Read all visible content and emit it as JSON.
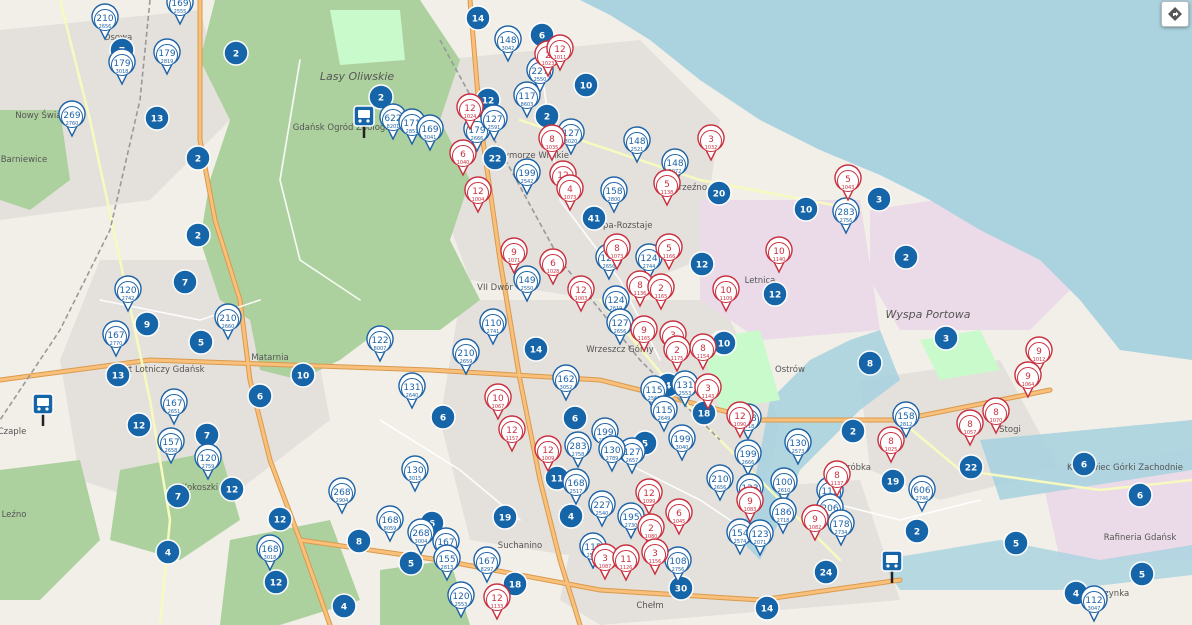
{
  "colors": {
    "water": "#aad3df",
    "land": "#f2efe9",
    "forest": "#add19e",
    "park": "#c8facc",
    "industrial": "#ebdbe8",
    "residential": "#e0dfdf",
    "highway": "#f8c07a",
    "highway_edge": "#d99a4e",
    "cluster_blue": "#1565a8",
    "pin_blue": "#1e63a6",
    "pin_red": "#c8303f"
  },
  "map_labels": [
    {
      "text": "Osowa"
    },
    {
      "text": "Nowy Świat"
    },
    {
      "text": "Barniewice"
    },
    {
      "text": "Matarnia"
    },
    {
      "text": "Lasy Oliwskie"
    },
    {
      "text": "Gdańsk Ogród Zoologiczny"
    },
    {
      "text": "Przymorze Wielkie"
    },
    {
      "text": "Brzeźno"
    },
    {
      "text": "Letnica"
    },
    {
      "text": "Wyspa Portowa"
    },
    {
      "text": "Stogi"
    },
    {
      "text": "Krakowiec Górki Zachodnie"
    },
    {
      "text": "Rafineria Gdańsk"
    },
    {
      "text": "Olszynka"
    },
    {
      "text": "Suchanino"
    },
    {
      "text": "Chełm"
    },
    {
      "text": "Kokoszki"
    },
    {
      "text": "Wrzeszcz Górny"
    },
    {
      "text": "VII Dwór"
    },
    {
      "text": "Zaspa-Rozstaje"
    },
    {
      "text": "Przeróbka"
    },
    {
      "text": "Ostrów"
    },
    {
      "text": "Czaple"
    },
    {
      "text": "Leźno"
    },
    {
      "text": "Port Lotniczy Gdańsk"
    }
  ],
  "clusters": [
    {
      "label": "14"
    },
    {
      "label": "6"
    },
    {
      "label": "10"
    },
    {
      "label": "12"
    },
    {
      "label": "22"
    },
    {
      "label": "41"
    },
    {
      "label": "2"
    },
    {
      "label": "2"
    },
    {
      "label": "13"
    },
    {
      "label": "7"
    },
    {
      "label": "2"
    },
    {
      "label": "2"
    },
    {
      "label": "7"
    },
    {
      "label": "9"
    },
    {
      "label": "5"
    },
    {
      "label": "13"
    },
    {
      "label": "10"
    },
    {
      "label": "6"
    },
    {
      "label": "12"
    },
    {
      "label": "7"
    },
    {
      "label": "7"
    },
    {
      "label": "12"
    },
    {
      "label": "12"
    },
    {
      "label": "4"
    },
    {
      "label": "12"
    },
    {
      "label": "4"
    },
    {
      "label": "8"
    },
    {
      "label": "5"
    },
    {
      "label": "6"
    },
    {
      "label": "20"
    },
    {
      "label": "10"
    },
    {
      "label": "12"
    },
    {
      "label": "12"
    },
    {
      "label": "10"
    },
    {
      "label": "3"
    },
    {
      "label": "2"
    },
    {
      "label": "8"
    },
    {
      "label": "3"
    },
    {
      "label": "2"
    },
    {
      "label": "22"
    },
    {
      "label": "19"
    },
    {
      "label": "6"
    },
    {
      "label": "6"
    },
    {
      "label": "5"
    },
    {
      "label": "5"
    },
    {
      "label": "4"
    },
    {
      "label": "24"
    },
    {
      "label": "14"
    },
    {
      "label": "18"
    },
    {
      "label": "30"
    },
    {
      "label": "19"
    },
    {
      "label": "4"
    },
    {
      "label": "6"
    },
    {
      "label": "14"
    },
    {
      "label": "6"
    },
    {
      "label": "11"
    },
    {
      "label": "5"
    },
    {
      "label": "2"
    },
    {
      "label": "4"
    },
    {
      "label": "10"
    },
    {
      "label": "18"
    },
    {
      "label": "2"
    }
  ],
  "pins_blue": [
    {
      "line": "210",
      "sub": "2656"
    },
    {
      "line": "169",
      "sub": "2555"
    },
    {
      "line": "179",
      "sub": "2819"
    },
    {
      "line": "179",
      "sub": "3018"
    },
    {
      "line": "269",
      "sub": "2760"
    },
    {
      "line": "148",
      "sub": "3042"
    },
    {
      "line": "117",
      "sub": "8603"
    },
    {
      "line": "227",
      "sub": "2550"
    },
    {
      "line": "622",
      "sub": "8201"
    },
    {
      "line": "171",
      "sub": "2851"
    },
    {
      "line": "169",
      "sub": "3041"
    },
    {
      "line": "179",
      "sub": "2666"
    },
    {
      "line": "127",
      "sub": "2591"
    },
    {
      "line": "199",
      "sub": "2542"
    },
    {
      "line": "127",
      "sub": "8020"
    },
    {
      "line": "148",
      "sub": "2521"
    },
    {
      "line": "148",
      "sub": "3072"
    },
    {
      "line": "158",
      "sub": "2800"
    },
    {
      "line": "283",
      "sub": "2756"
    },
    {
      "line": "124",
      "sub": "2744"
    },
    {
      "line": "127",
      "sub": "2656"
    },
    {
      "line": "149",
      "sub": "2550"
    },
    {
      "line": "124",
      "sub": "2619"
    },
    {
      "line": "127",
      "sub": "2656"
    },
    {
      "line": "110",
      "sub": "2741"
    },
    {
      "line": "122",
      "sub": "8007"
    },
    {
      "line": "210",
      "sub": "2659"
    },
    {
      "line": "120",
      "sub": "2742"
    },
    {
      "line": "167",
      "sub": "2770"
    },
    {
      "line": "210",
      "sub": "2660"
    },
    {
      "line": "131",
      "sub": "2640"
    },
    {
      "line": "162",
      "sub": "3052"
    },
    {
      "line": "115",
      "sub": "2562"
    },
    {
      "line": "167",
      "sub": "2651"
    },
    {
      "line": "157",
      "sub": "2658"
    },
    {
      "line": "120",
      "sub": "2759"
    },
    {
      "line": "199",
      "sub": "2545"
    },
    {
      "line": "199",
      "sub": "3040"
    },
    {
      "line": "108",
      "sub": "2718"
    },
    {
      "line": "130",
      "sub": "2573"
    },
    {
      "line": "127",
      "sub": "2657"
    },
    {
      "line": "283",
      "sub": "2758"
    },
    {
      "line": "130",
      "sub": "2789"
    },
    {
      "line": "130",
      "sub": "3015"
    },
    {
      "line": "168",
      "sub": "2517"
    },
    {
      "line": "199",
      "sub": "2666"
    },
    {
      "line": "158",
      "sub": "2812"
    },
    {
      "line": "268",
      "sub": "2904"
    },
    {
      "line": "210",
      "sub": "2656"
    },
    {
      "line": "123",
      "sub": "2751"
    },
    {
      "line": "100",
      "sub": "2610"
    },
    {
      "line": "111",
      "sub": "2620"
    },
    {
      "line": "606",
      "sub": "2746"
    },
    {
      "line": "227",
      "sub": "2540"
    },
    {
      "line": "195",
      "sub": "2730"
    },
    {
      "line": "186",
      "sub": "2718"
    },
    {
      "line": "206",
      "sub": "2619"
    },
    {
      "line": "178",
      "sub": "2734"
    },
    {
      "line": "168",
      "sub": "8059"
    },
    {
      "line": "268",
      "sub": "3004"
    },
    {
      "line": "167",
      "sub": "2813"
    },
    {
      "line": "154",
      "sub": "2574"
    },
    {
      "line": "123",
      "sub": "2071"
    },
    {
      "line": "168",
      "sub": "3018"
    },
    {
      "line": "155",
      "sub": "2813"
    },
    {
      "line": "167",
      "sub": "8297"
    },
    {
      "line": "115",
      "sub": "2516"
    },
    {
      "line": "108",
      "sub": "2756"
    },
    {
      "line": "120",
      "sub": "2553"
    },
    {
      "line": "112",
      "sub": "3047"
    },
    {
      "line": "131",
      "sub": "2553"
    },
    {
      "line": "115",
      "sub": "2649"
    }
  ],
  "pins_red": [
    {
      "line": "2",
      "sub": "1023"
    },
    {
      "line": "12",
      "sub": "1011"
    },
    {
      "line": "12",
      "sub": "1024"
    },
    {
      "line": "6",
      "sub": "1040"
    },
    {
      "line": "8",
      "sub": "1035"
    },
    {
      "line": "12",
      "sub": "1007"
    },
    {
      "line": "4",
      "sub": "1073"
    },
    {
      "line": "3",
      "sub": "1032"
    },
    {
      "line": "5",
      "sub": "1138"
    },
    {
      "line": "12",
      "sub": "1004"
    },
    {
      "line": "5",
      "sub": "1043"
    },
    {
      "line": "10",
      "sub": "1140"
    },
    {
      "line": "9",
      "sub": "1071"
    },
    {
      "line": "6",
      "sub": "1028"
    },
    {
      "line": "5",
      "sub": "1166"
    },
    {
      "line": "8",
      "sub": "1073"
    },
    {
      "line": "12",
      "sub": "1003"
    },
    {
      "line": "8",
      "sub": "1136"
    },
    {
      "line": "2",
      "sub": "1165"
    },
    {
      "line": "10",
      "sub": "1109"
    },
    {
      "line": "9",
      "sub": "1165"
    },
    {
      "line": "3",
      "sub": "1140"
    },
    {
      "line": "2",
      "sub": "1175"
    },
    {
      "line": "8",
      "sub": "1154"
    },
    {
      "line": "3",
      "sub": "1143"
    },
    {
      "line": "10",
      "sub": "1067"
    },
    {
      "line": "12",
      "sub": "1009"
    },
    {
      "line": "9",
      "sub": "1083"
    },
    {
      "line": "9",
      "sub": "1012"
    },
    {
      "line": "9",
      "sub": "1064"
    },
    {
      "line": "8",
      "sub": "1057"
    },
    {
      "line": "8",
      "sub": "1070"
    },
    {
      "line": "8",
      "sub": "1025"
    },
    {
      "line": "12",
      "sub": "1090"
    },
    {
      "line": "12",
      "sub": "1099"
    },
    {
      "line": "6",
      "sub": "1045"
    },
    {
      "line": "8",
      "sub": "1137"
    },
    {
      "line": "9",
      "sub": "1082"
    },
    {
      "line": "2",
      "sub": "1080"
    },
    {
      "line": "3",
      "sub": "1087"
    },
    {
      "line": "11",
      "sub": "1126"
    },
    {
      "line": "12",
      "sub": "1133"
    },
    {
      "line": "3",
      "sub": "1156"
    },
    {
      "line": "12",
      "sub": "1157"
    }
  ],
  "bus_markers": [
    {
      "name": "bus-stop-icon"
    },
    {
      "name": "bus-stop-icon"
    },
    {
      "name": "bus-stop-icon"
    }
  ]
}
